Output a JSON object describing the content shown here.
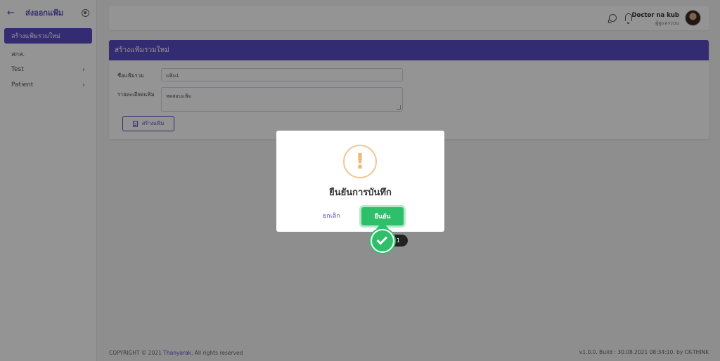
{
  "sidebar": {
    "title": "ส่งออกแฟ้ม",
    "items": [
      {
        "label": "สร้างแฟ้มรวมใหม่",
        "active": true
      },
      {
        "label": "สกส.",
        "active": false
      },
      {
        "label": "Test",
        "active": false
      },
      {
        "label": "Patient",
        "active": false
      }
    ]
  },
  "header": {
    "user_name": "Doctor na kub",
    "user_role": "ผู้ดูแลระบบ"
  },
  "card": {
    "title": "สร้างแฟ้มรวมใหม่",
    "name_label": "ชื่อแฟ้มรวม",
    "name_value": "แฟ้ม1",
    "desc_label": "รายละเอียดแฟ้ม",
    "desc_value": "ทดสอบแฟ้ม",
    "create_button": "สร้างแฟ้ม"
  },
  "dialog": {
    "icon": "!",
    "title": "ยืนยันการบันทึก",
    "cancel_label": "ยกเลิก",
    "confirm_label": "ยืนยัน"
  },
  "tutorial": {
    "step": "1"
  },
  "footer": {
    "copyright_prefix": "COPYRIGHT © 2021 ",
    "brand": "Thanyarak",
    "copyright_suffix": ", All rights reserved",
    "version": "v1.0.0. Build : 30.08.2021 08:34:10. by CK-THINK"
  },
  "colors": {
    "accent": "#5b4cc4",
    "confirm": "#2fbf6a",
    "warning": "#f0c89a"
  }
}
